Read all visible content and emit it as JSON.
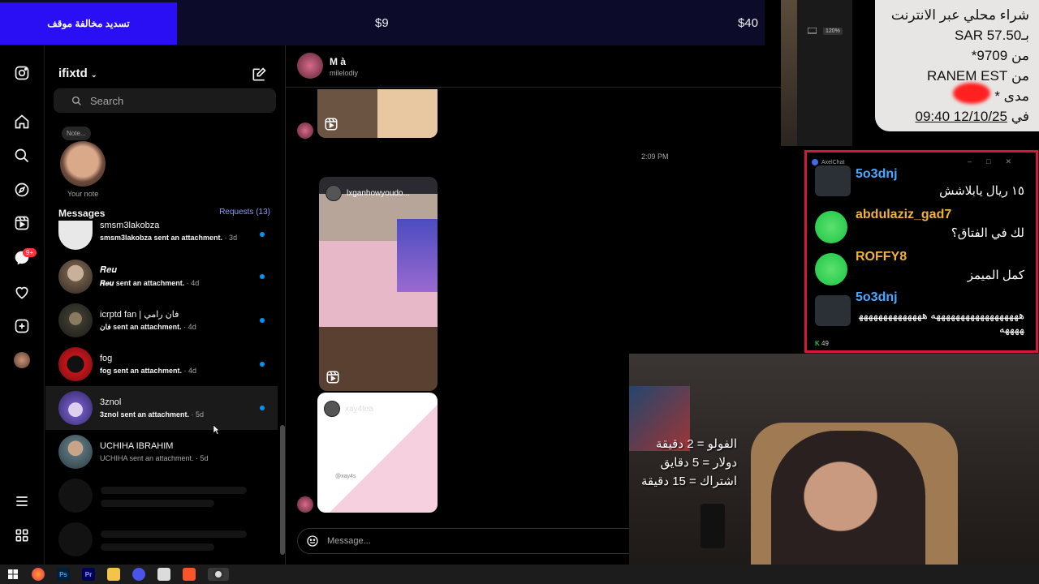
{
  "banner": {
    "left_label": "تسديد مخالفة موقف",
    "price_mid": "$9",
    "price_right": "$40",
    "colors": {
      "left_bg": "#2a0ff5",
      "bar_bg": "#0d0b2a"
    }
  },
  "nav": {
    "icons": [
      "instagram-icon",
      "home-icon",
      "search-icon",
      "explore-icon",
      "reels-icon",
      "messenger-icon",
      "notifications-icon",
      "create-icon",
      "profile-avatar",
      "menu-icon",
      "more-icon"
    ],
    "messages_badge": "9+"
  },
  "inbox": {
    "username": "ifixtd",
    "search_placeholder": "Search",
    "note_bubble": "Note...",
    "note_label": "Your note",
    "messages_title": "Messages",
    "requests_label": "Requests (13)",
    "conversations": [
      {
        "name": "smsm3lakobza",
        "preview": "smsm3lakobza sent an attachment.",
        "time": " · 3d",
        "unread": true,
        "avatar_color": "#e8e8e8"
      },
      {
        "name": "𝑹𝒆𝒖",
        "preview": "𝑹𝒆𝒖 sent an attachment.",
        "time": " · 4d",
        "unread": true,
        "avatar_color": "#6d5a48"
      },
      {
        "name": "icrptd fan | فان رامي",
        "preview": "فان sent an attachment.",
        "time": " · 4d",
        "unread": true,
        "avatar_color": "#3c3a30"
      },
      {
        "name": "fog",
        "preview": "fog sent an attachment.",
        "time": " · 4d",
        "unread": true,
        "avatar_color": "#c0151a"
      },
      {
        "name": "3znol",
        "preview": "3znol sent an attachment.",
        "time": " · 5d",
        "unread": true,
        "avatar_color": "#6a55b8"
      },
      {
        "name": "UCHIHA IBRAHIM",
        "preview": "UCHIHA sent an attachment.",
        "time": " · 5d",
        "unread": false,
        "avatar_color": "#58707a"
      }
    ]
  },
  "chat": {
    "name": "M à",
    "handle": "milelodiy",
    "timestamp": "2:09 PM",
    "reel_user_1": "lxganhowyoudo...",
    "reel_user_2": "xay4tea",
    "reel_caption_2": "@xay4s",
    "composer_placeholder": "Message..."
  },
  "toolbar": {
    "zoom": "120%"
  },
  "notice": {
    "line1": "شراء محلي عبر الانترنت",
    "line2": "بـSAR 57.50",
    "line3": "من 9709*",
    "line4": "من RANEM EST",
    "line5": "مدى *",
    "line6_prefix": "في ",
    "line6_datetime": "09:40 12/10/25"
  },
  "axelchat": {
    "title": "AxelChat",
    "viewer_count": "49",
    "messages": [
      {
        "user": "5o3dnj",
        "text": "١٥ ريال يابلاشش",
        "user_color": "#4aa8ff",
        "avatar_color": "#2b2f36"
      },
      {
        "user": "abdulaziz_gad7",
        "text": "لك في الفتاق؟",
        "user_color": "#f2b233",
        "avatar_color": "#19c542"
      },
      {
        "user": "ROFFY8",
        "text": "كمل الميمز",
        "user_color": "#f2b233",
        "avatar_color": "#19c542"
      },
      {
        "user": "5o3dnj",
        "text": "ههههههههههههههههههه ههههههههههههههههههه",
        "user_color": "#4aa8ff",
        "avatar_color": "#2b2f36"
      }
    ]
  },
  "webcam": {
    "rules": [
      "الفولو = 2 دقيقة",
      "دولار = 5 دقايق",
      "اشتراك = 15 دقيقة"
    ]
  },
  "taskbar": {
    "apps": [
      "windows-icon",
      "firefox-icon",
      "photoshop-icon",
      "premiere-icon",
      "file-explorer-icon",
      "media-icon",
      "calendar-icon",
      "brave-icon",
      "obs-icon"
    ]
  }
}
